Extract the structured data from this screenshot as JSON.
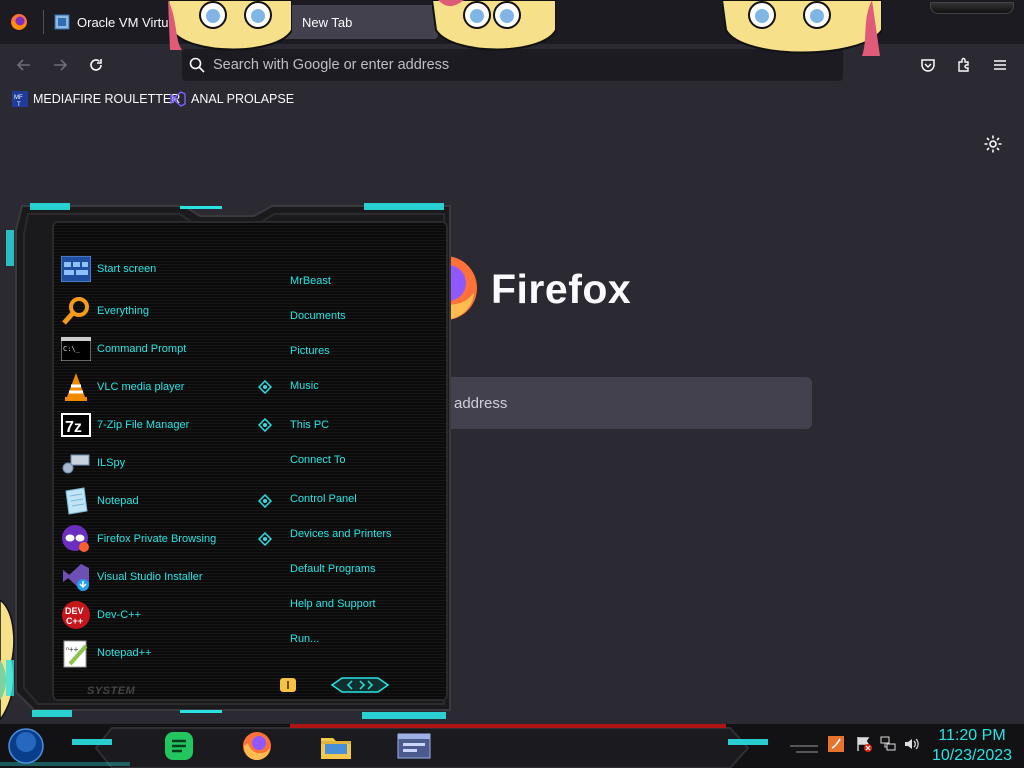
{
  "browser": {
    "tabs": [
      {
        "title": "Oracle VM Virtual"
      },
      {
        "title": "New Tab"
      }
    ],
    "urlbar": {
      "placeholder": "Search with Google or enter address"
    },
    "bookmarks": [
      {
        "label": "MEDIAFIRE ROULETTER",
        "icon": "mediafire-icon"
      },
      {
        "label": "ANAL PROLAPSE",
        "icon": "visual-studio-icon"
      }
    ],
    "newtab": {
      "brand": "Firefox",
      "search_placeholder_visible": "address"
    }
  },
  "startmenu": {
    "apps": [
      {
        "label": "Start screen",
        "icon": "start-screen-icon"
      },
      {
        "label": "Everything",
        "icon": "magnifier-icon"
      },
      {
        "label": "Command Prompt",
        "icon": "terminal-icon"
      },
      {
        "label": "VLC media player",
        "icon": "vlc-cone-icon"
      },
      {
        "label": "7-Zip File Manager",
        "icon": "7zip-icon"
      },
      {
        "label": "ILSpy",
        "icon": "ilspy-icon"
      },
      {
        "label": "Notepad",
        "icon": "notepad-icon"
      },
      {
        "label": "Firefox Private Browsing",
        "icon": "private-browsing-icon"
      },
      {
        "label": "Visual Studio Installer",
        "icon": "visual-studio-installer-icon"
      },
      {
        "label": "Dev-C++",
        "icon": "devcpp-icon"
      },
      {
        "label": "Notepad++",
        "icon": "notepadpp-icon"
      }
    ],
    "places": [
      {
        "label": "MrBeast"
      },
      {
        "label": "Documents"
      },
      {
        "label": "Pictures"
      },
      {
        "label": "Music"
      },
      {
        "label": "This PC"
      },
      {
        "label": "Connect To"
      },
      {
        "label": "Control Panel"
      },
      {
        "label": "Devices and Printers"
      },
      {
        "label": "Default Programs"
      },
      {
        "label": "Help and Support"
      },
      {
        "label": "Run..."
      }
    ],
    "system_label": "SYSTEM"
  },
  "taskbar": {
    "pinned": [
      "notes-app-icon",
      "firefox-icon",
      "file-explorer-icon",
      "virtualbox-icon"
    ],
    "clock": {
      "time": "11:20 PM",
      "date": "10/23/2023"
    }
  },
  "colors": {
    "accent": "#29e3e3",
    "browser_bg": "#2b2a33",
    "tabbar_bg": "#1c1b22"
  }
}
